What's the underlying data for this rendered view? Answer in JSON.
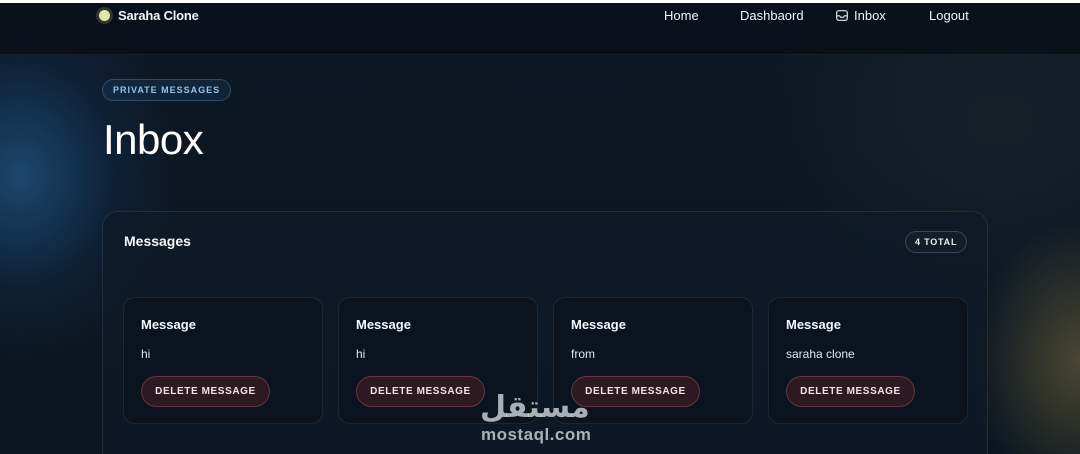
{
  "brand": {
    "name": "Saraha Clone"
  },
  "nav": {
    "home": "Home",
    "dashboard": "Dashbaord",
    "inbox": "Inbox",
    "logout": "Logout"
  },
  "header": {
    "pill": "PRIVATE MESSAGES",
    "title": "Inbox"
  },
  "panel": {
    "title": "Messages",
    "total_badge": "4 TOTAL"
  },
  "messages": [
    {
      "title": "Message",
      "text": "hi",
      "delete_label": "DELETE MESSAGE"
    },
    {
      "title": "Message",
      "text": "hi",
      "delete_label": "DELETE MESSAGE"
    },
    {
      "title": "Message",
      "text": "from",
      "delete_label": "DELETE MESSAGE"
    },
    {
      "title": "Message",
      "text": "saraha clone",
      "delete_label": "DELETE MESSAGE"
    }
  ],
  "watermark": {
    "arabic": "مستقل",
    "latin": "mostaql.com"
  },
  "colors": {
    "accent_pill_text": "#8fc4ec",
    "brand_dot": "#e2e6a8",
    "delete_button_bg": "#46242a",
    "background": "#0c1622"
  }
}
